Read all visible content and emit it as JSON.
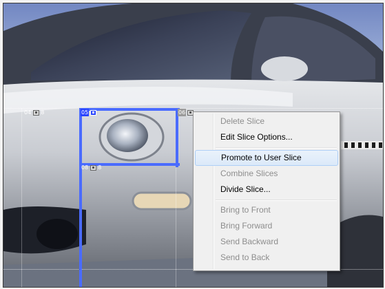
{
  "slices": [
    {
      "id": "04",
      "style": "normal"
    },
    {
      "id": "05",
      "style": "selected"
    },
    {
      "id": "08",
      "style": "normal"
    },
    {
      "id": "06",
      "style": "grey"
    }
  ],
  "context_menu": {
    "items": [
      {
        "label": "Delete Slice",
        "enabled": false
      },
      {
        "label": "Edit Slice Options...",
        "enabled": true
      },
      {
        "separator": true
      },
      {
        "label": "Promote to User Slice",
        "enabled": true,
        "highlighted": true
      },
      {
        "label": "Combine Slices",
        "enabled": false
      },
      {
        "label": "Divide Slice...",
        "enabled": true
      },
      {
        "separator": true
      },
      {
        "label": "Bring to Front",
        "enabled": false
      },
      {
        "label": "Bring Forward",
        "enabled": false
      },
      {
        "label": "Send Backward",
        "enabled": false
      },
      {
        "label": "Send to Back",
        "enabled": false
      }
    ]
  },
  "colors": {
    "selection_blue": "#2a45ff",
    "menu_bg": "#f0f0f0",
    "menu_disabled_text": "#8d8d8d",
    "menu_highlight": "#dbe9f9"
  }
}
